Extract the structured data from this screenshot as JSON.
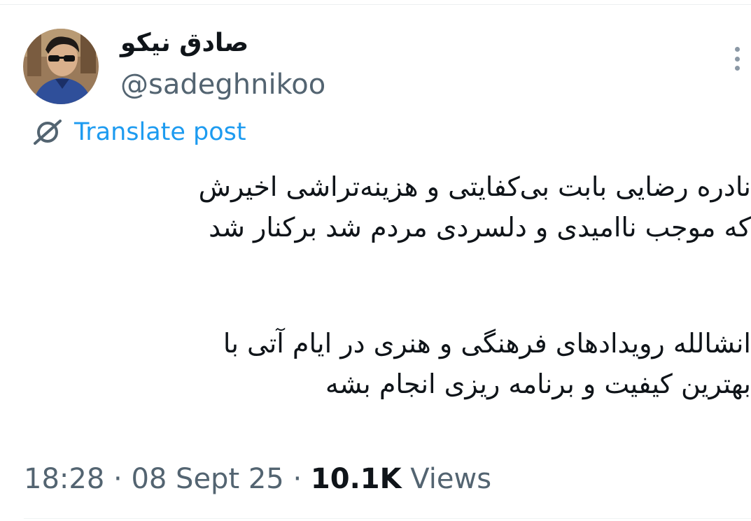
{
  "author": {
    "display_name": "صادق نیکو",
    "handle": "@sadeghnikoo",
    "avatar_icon": "profile-photo"
  },
  "translate": {
    "icon": "globe-slash-icon",
    "label": "Translate post"
  },
  "post": {
    "lines": [
      "نادره رضایی بابت بی‌کفایتی و هزینه‌تراشی اخیرش",
      "که موجب ناامیدی و دلسردی مردم شد برکنار شد",
      "انشالله رویدادهای فرهنگی و هنری در ایام آتی با",
      "بهترین کیفیت و برنامه ریزی انجام بشه"
    ]
  },
  "meta": {
    "time": "18:28",
    "separator": " · ",
    "date": "08 Sept 25",
    "views_count": "10.1K",
    "views_label": " Views"
  },
  "colors": {
    "text_primary": "#0f1419",
    "text_secondary": "#536471",
    "link_blue": "#1d9bf0"
  }
}
